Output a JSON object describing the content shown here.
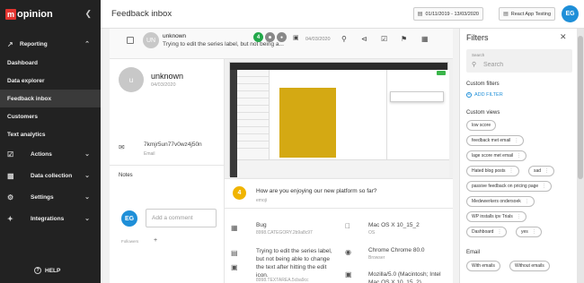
{
  "app": {
    "logo_mark": "m",
    "logo_text": "opinion"
  },
  "sidebar": {
    "reporting_label": "Reporting",
    "items": [
      {
        "label": "Dashboard"
      },
      {
        "label": "Data explorer"
      },
      {
        "label": "Feedback inbox",
        "active": true
      },
      {
        "label": "Customers"
      },
      {
        "label": "Text analytics"
      }
    ],
    "groups": [
      {
        "label": "Actions",
        "icon": "check-square-icon"
      },
      {
        "label": "Data collection",
        "icon": "clipboard-icon"
      },
      {
        "label": "Settings",
        "icon": "gear-icon"
      },
      {
        "label": "Integrations",
        "icon": "puzzle-icon"
      }
    ],
    "help_label": "HELP"
  },
  "header": {
    "title": "Feedback inbox",
    "date_range": "01/11/2019 - 13/03/2020",
    "project": "React App Testing",
    "user_initials": "EG"
  },
  "feedback": {
    "avatar_initials": "UN",
    "name": "unknown",
    "snippet": "Trying to edit the series label, but not being a...",
    "badge_score": "4",
    "date": "04/03/2020"
  },
  "detail": {
    "avatar_initials": "u",
    "name": "unknown",
    "date": "04/03/2020",
    "email": "7kmjr5un77v0wz4j50n",
    "email_label": "Email",
    "notes_label": "Notes",
    "note_initials": "EG",
    "comment_placeholder": "Add a comment",
    "followers_label": "Followers",
    "followers_add": "+"
  },
  "question": {
    "score": "4",
    "text": "How are you enjoying our new platform so far?",
    "answer": "emoji"
  },
  "metadata": [
    {
      "icon": "bug-icon",
      "value": "Bug",
      "label": "8998.CATEGORY.2b9a8c97"
    },
    {
      "icon": "apple-icon",
      "value": "Mac OS X 10_15_2",
      "label": "OS"
    },
    {
      "icon": "text-icon",
      "value": "Trying to edit the series label, but not being able to change the text after hitting the edit icon.",
      "label": "8998.TEXTAREA.5cba9cc"
    },
    {
      "icon": "chrome-icon",
      "value": "Chrome Chrome 80.0",
      "label": "Browser"
    },
    {
      "icon": "window-icon",
      "value": "Mozilla/5.0 (Macintosh; Intel Mac OS X 10_15_2)",
      "label": ""
    }
  ],
  "filters": {
    "title": "Filters",
    "search_label": "Search",
    "search_placeholder": "Search",
    "custom_filters_label": "Custom filters",
    "add_filter_label": "ADD FILTER",
    "custom_views_label": "Custom views",
    "views": [
      "low score",
      "feedback met email",
      "lage score met email",
      "Hated blog posts",
      "sad",
      "passive feedback on pricing page",
      "Medewerkers ondersoek",
      "WP installs ipv Trials",
      "Dashboard",
      "yes"
    ],
    "email_label": "Email",
    "email_options": [
      "With emails",
      "Without emails"
    ]
  },
  "colors": {
    "sidebar_bg": "#222222",
    "accent_blue": "#1f8fd8",
    "score_green": "#22a84a",
    "score_yellow": "#f0b400",
    "brand_red": "#e3342f"
  }
}
